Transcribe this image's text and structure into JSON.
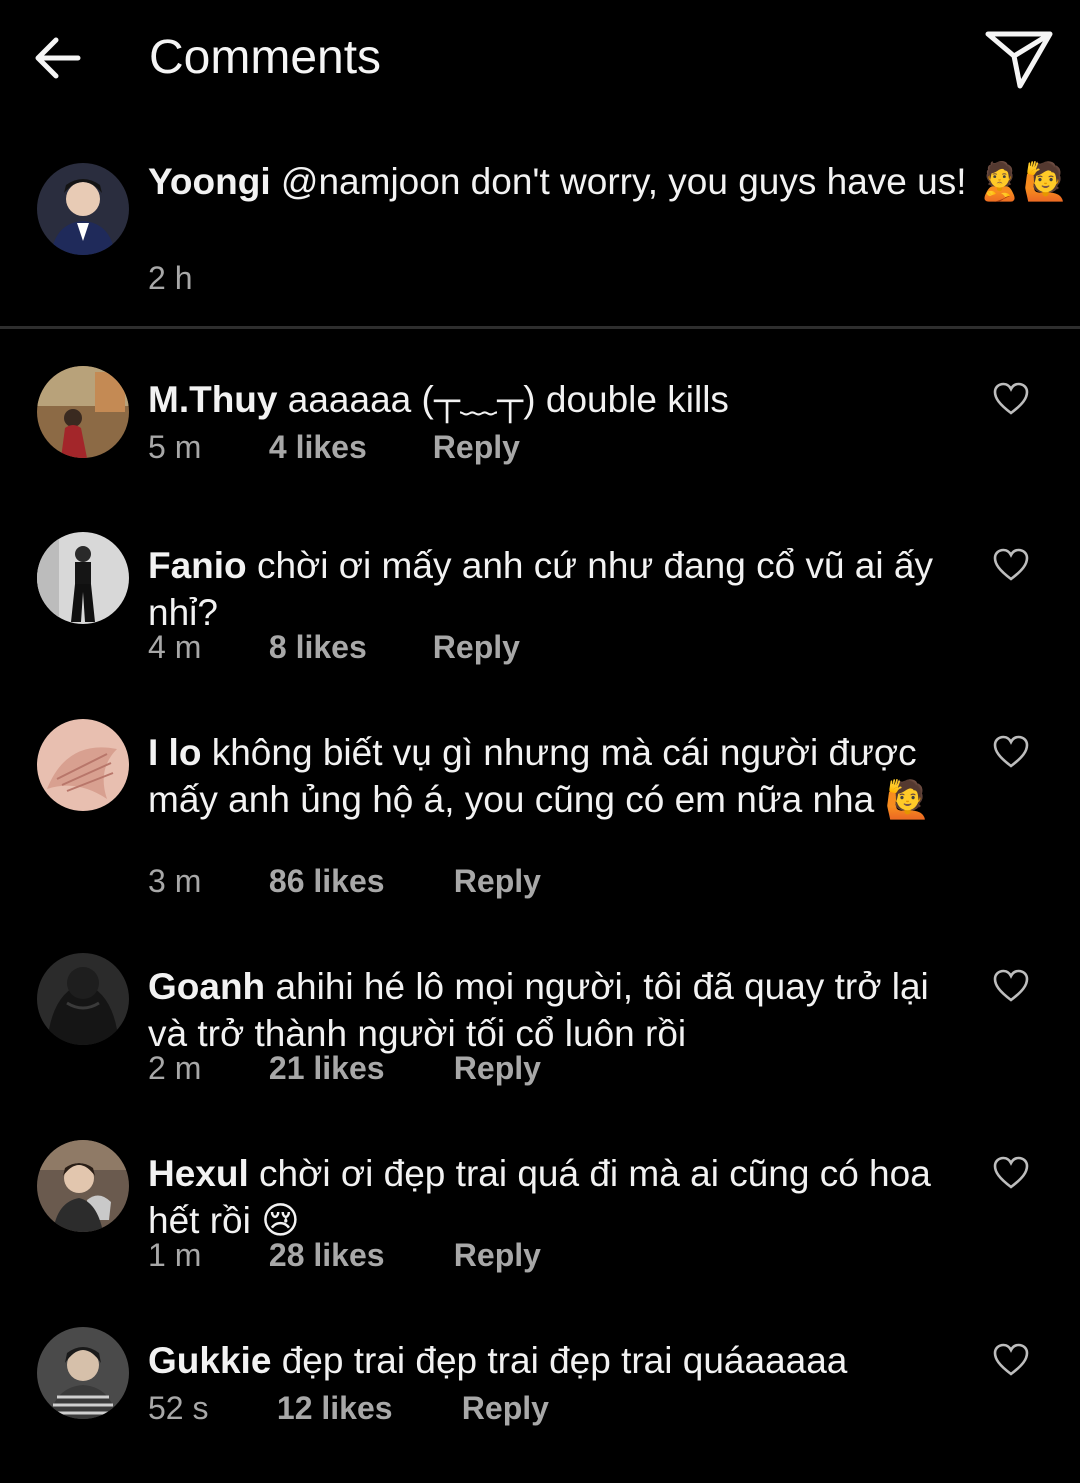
{
  "header": {
    "title": "Comments",
    "back_icon": "back-arrow-icon",
    "send_icon": "paper-plane-icon"
  },
  "caption": {
    "username": "Yoongi",
    "text": "@namjoon don't worry, you guys have us! 🙎🙋",
    "time": "2 h"
  },
  "comments": [
    {
      "username": "M.Thuy",
      "text": "aaaaaa (┬﹏┬) double kills",
      "time": "5 m",
      "likes": "4 likes",
      "reply": "Reply"
    },
    {
      "username": "Fanio",
      "text": "chời ơi mấy anh cứ như đang cổ vũ ai ấy nhỉ?",
      "time": "4 m",
      "likes": "8 likes",
      "reply": "Reply"
    },
    {
      "username": "I lo",
      "text": "không biết vụ gì nhưng mà cái người được mấy anh ủng hộ á, you cũng có em nữa nha 🙋",
      "time": "3 m",
      "likes": "86 likes",
      "reply": "Reply"
    },
    {
      "username": "Goanh",
      "text": "ahihi hé lô mọi người, tôi đã quay trở lại và trở thành người tối cổ luôn rồi",
      "time": "2 m",
      "likes": "21 likes",
      "reply": "Reply"
    },
    {
      "username": "Hexul",
      "text": "chời ơi đẹp trai quá đi mà ai cũng có hoa hết rồi 😢",
      "time": "1 m",
      "likes": "28 likes",
      "reply": "Reply"
    },
    {
      "username": "Gukkie",
      "text": "đẹp trai đẹp trai đẹp trai quáaaaaa",
      "time": "52 s",
      "likes": "12 likes",
      "reply": "Reply"
    }
  ],
  "colors": {
    "background": "#000000",
    "text": "#f2f2f2",
    "secondary": "#a8a8a8",
    "divider": "#2e2e2e"
  }
}
